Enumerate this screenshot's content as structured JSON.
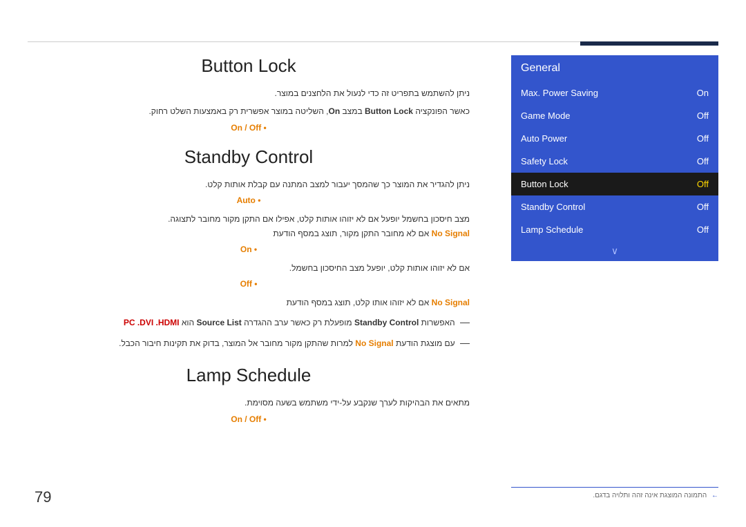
{
  "page": {
    "number": "79",
    "top_bar_color": "#1a2a4a"
  },
  "panel": {
    "header": "General",
    "menu_items": [
      {
        "label": "Max. Power Saving",
        "value": "On",
        "selected": false
      },
      {
        "label": "Game Mode",
        "value": "Off",
        "selected": false
      },
      {
        "label": "Auto Power",
        "value": "Off",
        "selected": false
      },
      {
        "label": "Safety Lock",
        "value": "Off",
        "selected": false
      },
      {
        "label": "Button Lock",
        "value": "Off",
        "selected": true
      },
      {
        "label": "Standby Control",
        "value": "Off",
        "selected": false
      },
      {
        "label": "Lamp Schedule",
        "value": "Off",
        "selected": false
      }
    ],
    "chevron": "∨"
  },
  "bottom_note": {
    "arrow": "←",
    "text": "התמונה המוצגת אינה זהה ותלויה בדגם."
  },
  "sections": [
    {
      "id": "button-lock",
      "title": "Button Lock",
      "paragraphs": [
        "ניתן להשתמש בתפריט זה כדי לנעול את הלחצנים במוצר.",
        "כאשר הפונקציה Button Lock במצב On, השליטה במוצר אפשרית רק באמצעות השלט רחוק."
      ],
      "on_off": "On / Off •"
    },
    {
      "id": "standby-control",
      "title": "Standby Control",
      "paragraphs": [
        "ניתן להגדיר את המוצר כך שהמסך יעבור למצב המתנה עם קבלת אותות קלט.",
        "מצב חיסכון בחשמל יופעל אם לא יזוהו אותות קלט, אפילו אם התקן מקור מחובר לתצוגה.",
        "אם לא מחובר התקן מקור, תוצג במסף הודעת No Signal."
      ],
      "auto_label": "Auto •",
      "on_label": "On •",
      "on_desc": "אם לא יזוהו אותות קלט, יופעל מצב החיסכון בחשמל.",
      "off_label": "Off •",
      "off_desc": "אם לא יזוהו אותו קלט, תוצג במסף הודעת No Signal.",
      "note1": "האפשרות Standby Control מופעלת רק כאשר ערב ההגדרה Source List הוא PC .DVI .HDMI",
      "note2": "עם מוצגת הודעת No Signal למרות שהתקן מקור מחובר אל המוצר, בדוק את תקינות חיבור הכבל."
    },
    {
      "id": "lamp-schedule",
      "title": "Lamp Schedule",
      "paragraphs": [
        "מתאים את הבהיקות לערך שנקבע על-ידי משתמש בשעה מסוימת."
      ],
      "on_off": "On / Off •"
    }
  ]
}
